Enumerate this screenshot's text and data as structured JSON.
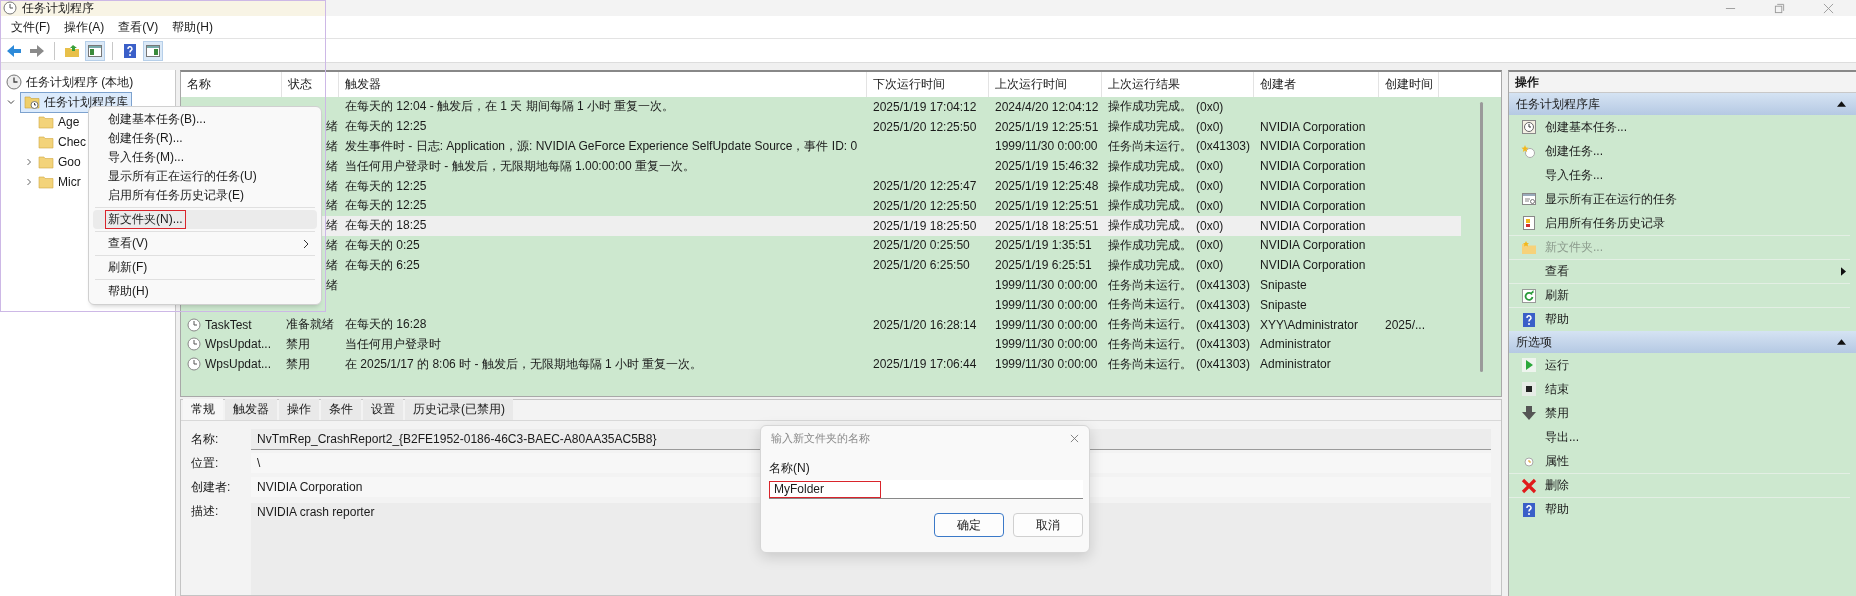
{
  "window": {
    "title": "任务计划程序"
  },
  "menu_bar": [
    "文件(F)",
    "操作(A)",
    "查看(V)",
    "帮助(H)"
  ],
  "toolbar": [
    {
      "kind": "back",
      "pressed": false
    },
    {
      "kind": "forward",
      "pressed": false
    },
    {
      "kind": "separator"
    },
    {
      "kind": "up",
      "pressed": false
    },
    {
      "kind": "tree-pane",
      "pressed": true
    },
    {
      "kind": "separator"
    },
    {
      "kind": "help",
      "pressed": false
    },
    {
      "kind": "action-pane",
      "pressed": true
    }
  ],
  "tree": {
    "label": "任务计划程序 (本地)",
    "children": [
      {
        "label": "任务计划程序库",
        "expanded": true,
        "selected": true,
        "children": [
          {
            "label": "Age"
          },
          {
            "label": "Chec"
          },
          {
            "label": "Goo",
            "expanded": false
          },
          {
            "label": "Micr",
            "expanded": false
          }
        ]
      }
    ]
  },
  "table": {
    "columns": [
      "名称",
      "状态",
      "触发器",
      "下次运行时间",
      "上次运行时间",
      "上次运行结果",
      "创建者",
      "创建时间"
    ],
    "rows": [
      {
        "trigger": "在每天的 12:04 - 触发后，在 1 天 期间每隔 1 小时 重复一次。",
        "next_run": "2025/1/19 17:04:12",
        "last_run": "2024/4/20 12:04:12",
        "result": "操作成功完成。",
        "code": "(0x0)",
        "selected": false
      },
      {
        "status_tail": "绪",
        "trigger": "在每天的 12:25",
        "next_run": "2025/1/20 12:25:50",
        "last_run": "2025/1/19 12:25:51",
        "result": "操作成功完成。",
        "code": "(0x0)",
        "creator": "NVIDIA Corporation",
        "selected": false
      },
      {
        "status_tail": "绪",
        "trigger": "发生事件时 - 日志: Application，源: NVIDIA GeForce Experience SelfUpdate Source，事件 ID: 0",
        "last_run": "1999/11/30 0:00:00",
        "result": "任务尚未运行。",
        "code": "(0x41303)",
        "creator": "NVIDIA Corporation",
        "selected": false
      },
      {
        "status_tail": "绪",
        "trigger": "当任何用户登录时 - 触发后，无限期地每隔 1.00:00:00 重复一次。",
        "last_run": "2025/1/19 15:46:32",
        "result": "操作成功完成。",
        "code": "(0x0)",
        "creator": "NVIDIA Corporation",
        "selected": false
      },
      {
        "status_tail": "绪",
        "trigger": "在每天的 12:25",
        "next_run": "2025/1/20 12:25:47",
        "last_run": "2025/1/19 12:25:48",
        "result": "操作成功完成。",
        "code": "(0x0)",
        "creator": "NVIDIA Corporation",
        "selected": false
      },
      {
        "status_tail": "绪",
        "trigger": "在每天的 12:25",
        "next_run": "2025/1/20 12:25:50",
        "last_run": "2025/1/19 12:25:51",
        "result": "操作成功完成。",
        "code": "(0x0)",
        "creator": "NVIDIA Corporation",
        "selected": false
      },
      {
        "status_tail": "绪",
        "trigger": "在每天的 18:25",
        "next_run": "2025/1/19 18:25:50",
        "last_run": "2025/1/18 18:25:51",
        "result": "操作成功完成。",
        "code": "(0x0)",
        "creator": "NVIDIA Corporation",
        "selected": true
      },
      {
        "status_tail": "绪",
        "trigger": "在每天的 0:25",
        "next_run": "2025/1/20 0:25:50",
        "last_run": "2025/1/19 1:35:51",
        "result": "操作成功完成。",
        "code": "(0x0)",
        "creator": "NVIDIA Corporation",
        "selected": false
      },
      {
        "status_tail": "绪",
        "trigger": "在每天的 6:25",
        "next_run": "2025/1/20 6:25:50",
        "last_run": "2025/1/19 6:25:51",
        "result": "操作成功完成。",
        "code": "(0x0)",
        "creator": "NVIDIA Corporation",
        "selected": false
      },
      {
        "status_tail": "绪",
        "last_run": "1999/11/30 0:00:00",
        "result": "任务尚未运行。",
        "code": "(0x41303)",
        "creator": "Snipaste",
        "selected": false
      },
      {
        "last_run": "1999/11/30 0:00:00",
        "result": "任务尚未运行。",
        "code": "(0x41303)",
        "creator": "Snipaste",
        "selected": false
      },
      {
        "name": "TaskTest",
        "status": "准备就绪",
        "trigger": "在每天的 16:28",
        "next_run": "2025/1/20 16:28:14",
        "last_run": "1999/11/30 0:00:00",
        "result": "任务尚未运行。",
        "code": "(0x41303)",
        "creator": "XYY\\Administrator",
        "created": "2025/...",
        "selected": false
      },
      {
        "name": "WpsUpdat...",
        "status": "禁用",
        "trigger": "当任何用户登录时",
        "last_run": "1999/11/30 0:00:00",
        "result": "任务尚未运行。",
        "code": "(0x41303)",
        "creator": "Administrator",
        "selected": false
      },
      {
        "name": "WpsUpdat...",
        "status": "禁用",
        "trigger": "在 2025/1/17 的 8:06 时 - 触发后，无限期地每隔 1 小时 重复一次。",
        "next_run": "2025/1/19 17:06:44",
        "last_run": "1999/11/30 0:00:00",
        "result": "任务尚未运行。",
        "code": "(0x41303)",
        "creator": "Administrator",
        "selected": false
      }
    ]
  },
  "details": {
    "tabs": [
      {
        "label": "常规",
        "selected": true
      },
      {
        "label": "触发器",
        "selected": false
      },
      {
        "label": "操作",
        "selected": false
      },
      {
        "label": "条件",
        "selected": false
      },
      {
        "label": "设置",
        "selected": false
      },
      {
        "label": "历史记录(已禁用)",
        "selected": false
      }
    ],
    "fields": [
      {
        "kind": "line",
        "label": "名称:",
        "value": "NvTmRep_CrashReport2_{B2FE1952-0186-46C3-BAEC-A80AA35AC5B8}"
      },
      {
        "kind": "plain",
        "label": "位置:",
        "value": "\\"
      },
      {
        "kind": "plain",
        "label": "创建者:",
        "value": "NVIDIA Corporation"
      },
      {
        "kind": "area",
        "label": "描述:",
        "value": "NVIDIA crash reporter"
      }
    ]
  },
  "actions": {
    "title": "操作",
    "groups": [
      {
        "title": "任务计划程序库",
        "expanded": true,
        "items": [
          {
            "label": "创建基本任务...",
            "disabled": false,
            "divided": false
          },
          {
            "label": "创建任务...",
            "disabled": false,
            "divided": false
          },
          {
            "label": "导入任务...",
            "disabled": false,
            "divided": false
          },
          {
            "label": "显示所有正在运行的任务",
            "disabled": false,
            "divided": false
          },
          {
            "label": "启用所有任务历史记录",
            "disabled": false,
            "divided": false
          },
          {
            "label": "新文件夹...",
            "disabled": true,
            "divided": true
          },
          {
            "label": "查看",
            "disabled": false,
            "divided": true,
            "submenu": true
          },
          {
            "label": "刷新",
            "disabled": false,
            "divided": true
          },
          {
            "label": "帮助",
            "disabled": false,
            "divided": true
          }
        ]
      },
      {
        "title": "所选项",
        "expanded": true,
        "items": [
          {
            "label": "运行",
            "disabled": false,
            "divided": false
          },
          {
            "label": "结束",
            "disabled": false,
            "divided": false
          },
          {
            "label": "禁用",
            "disabled": false,
            "divided": false
          },
          {
            "label": "导出...",
            "disabled": false,
            "divided": false
          },
          {
            "label": "属性",
            "disabled": false,
            "divided": false
          },
          {
            "label": "删除",
            "disabled": false,
            "divided": true
          },
          {
            "label": "帮助",
            "disabled": false,
            "divided": true
          }
        ]
      }
    ]
  },
  "context_menu": [
    {
      "kind": "item",
      "label": "创建基本任务(B)...",
      "selected": false,
      "marked": false
    },
    {
      "kind": "item",
      "label": "创建任务(R)...",
      "selected": false,
      "marked": false
    },
    {
      "kind": "item",
      "label": "导入任务(M)...",
      "selected": false,
      "marked": false
    },
    {
      "kind": "item",
      "label": "显示所有正在运行的任务(U)",
      "selected": false,
      "marked": false
    },
    {
      "kind": "item",
      "label": "启用所有任务历史记录(E)",
      "selected": false,
      "marked": false
    },
    {
      "kind": "separator"
    },
    {
      "kind": "item",
      "label": "新文件夹(N)...",
      "selected": true,
      "marked": true
    },
    {
      "kind": "separator"
    },
    {
      "kind": "item",
      "label": "查看(V)",
      "selected": false,
      "marked": false,
      "submenu": true
    },
    {
      "kind": "separator"
    },
    {
      "kind": "item",
      "label": "刷新(F)",
      "selected": false,
      "marked": false
    },
    {
      "kind": "separator"
    },
    {
      "kind": "item",
      "label": "帮助(H)",
      "selected": false,
      "marked": false
    }
  ],
  "dialog": {
    "title": "输入新文件夹的名称",
    "label": "名称(N)",
    "value": "MyFolder",
    "marked": true,
    "buttons": [
      {
        "label": "确定",
        "default": true
      },
      {
        "label": "取消",
        "default": false
      }
    ]
  }
}
